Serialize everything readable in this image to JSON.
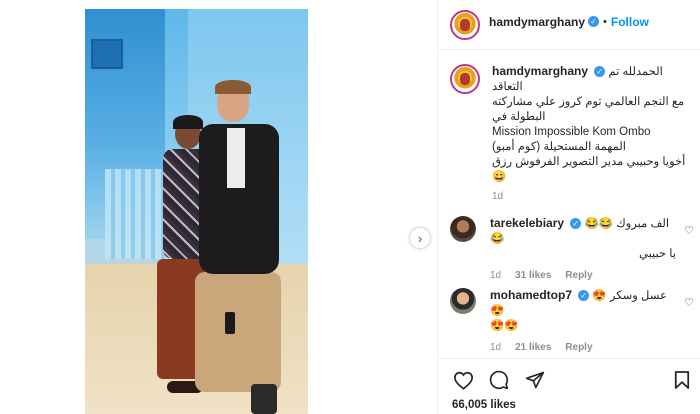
{
  "post": {
    "username": "hamdymarghany",
    "follow_label": "Follow",
    "dot": "•",
    "caption_lines": [
      "الحمدلله تم التعاقد",
      "مع النجم العالمي توم كروز علي مشاركته",
      "البطولة في",
      "Mission Impossible Kom Ombo",
      "المهمة المستحيلة (كوم أمبو)",
      "أخويا وحبيبي مدير التصوير الفرفوش رزق",
      "😄"
    ],
    "caption_time": "1d",
    "likes": "66,005 likes"
  },
  "comments": [
    {
      "username": "tarekelebiary",
      "text_line1": "الف مبروك 😂😂😂",
      "text_line2": "يا حبيبي",
      "time": "1d",
      "likes": "31 likes",
      "reply": "Reply"
    },
    {
      "username": "mohamedtop7",
      "text_line1": "عسل وسكر 😍😍",
      "text_line2": "😍😍",
      "time": "1d",
      "likes": "21 likes",
      "reply": "Reply"
    }
  ],
  "icons": {
    "next": "›",
    "heart": "♡",
    "verified": "✓"
  },
  "colors": {
    "accent": "#0095f6",
    "verified": "#3897f0",
    "muted": "#8e8e8e"
  }
}
